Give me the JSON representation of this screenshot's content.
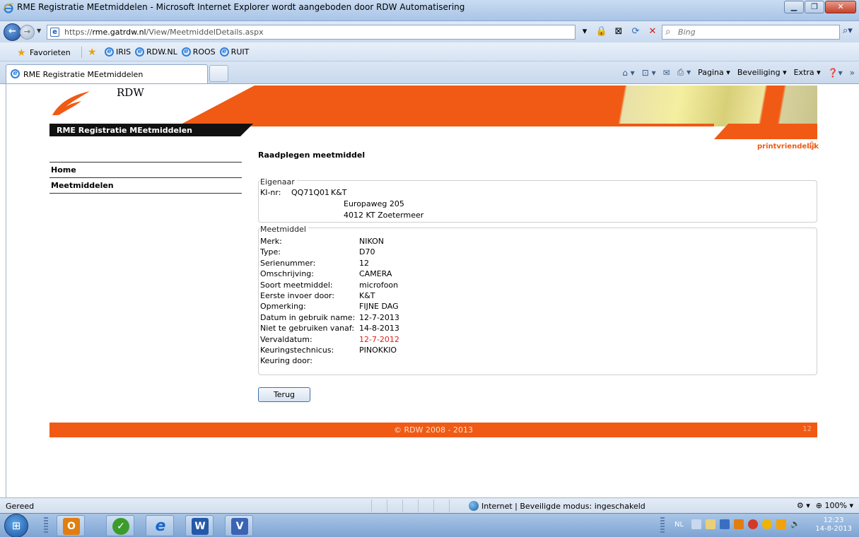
{
  "window": {
    "title": "RME Registratie MEetmiddelen - Microsoft Internet Explorer wordt aangeboden door RDW Automatisering",
    "min_icon": "minimize-icon",
    "max_icon": "maximize-icon",
    "close_icon": "close-icon"
  },
  "addressbar": {
    "url_prefix": "https://",
    "url_host": "rme.gatrdw.nl",
    "url_path": "/View/MeetmiddelDetails.aspx",
    "search_placeholder": "Bing"
  },
  "favorites": {
    "label": "Favorieten",
    "links": [
      "IRIS",
      "RDW.NL",
      "ROOS",
      "RUIT"
    ]
  },
  "tab": {
    "label": "RME Registratie MEetmiddelen"
  },
  "commandbar": {
    "pagina": "Pagina",
    "beveiliging": "Beveiliging",
    "extra": "Extra"
  },
  "page": {
    "brand": "RDW",
    "app_title": "RME Registratie MEetmiddelen",
    "print_link": "printvriendelijk",
    "content_title": "Raadplegen meetmiddel",
    "nav": [
      "Home",
      "Meetmiddelen"
    ],
    "owner": {
      "legend": "Eigenaar",
      "ki_label": "KI-nr:",
      "ki_value": "QQ71Q01",
      "name": "K&T",
      "address1": "Europaweg 205",
      "address2": "4012 KT Zoetermeer"
    },
    "tool": {
      "legend": "Meetmiddel",
      "rows": [
        {
          "k": "Merk:",
          "v": "NIKON"
        },
        {
          "k": "Type:",
          "v": "D70"
        },
        {
          "k": "Serienummer:",
          "v": "12"
        },
        {
          "k": "Omschrijving:",
          "v": "CAMERA"
        },
        {
          "k": "Soort meetmiddel:",
          "v": "microfoon"
        },
        {
          "k": "Eerste invoer door:",
          "v": "K&T"
        },
        {
          "k": "Opmerking:",
          "v": "FIJNE DAG"
        },
        {
          "k": "Datum in gebruik name:",
          "v": "12-7-2013"
        },
        {
          "k": "Niet te gebruiken vanaf:",
          "v": "14-8-2013"
        },
        {
          "k": "Vervaldatum:",
          "v": "12-7-2012"
        },
        {
          "k": "Keuringstechnicus:",
          "v": "PINOKKIO"
        },
        {
          "k": "Keuring door:",
          "v": ""
        }
      ],
      "expired_color": "#e0201b"
    },
    "back_button": "Terug",
    "footer_copy": "© RDW 2008 - 2013",
    "footer_version": "12",
    "brand_color": "#f05a14"
  },
  "statusbar": {
    "status": "Gereed",
    "zone": "Internet | Beveiligde modus: ingeschakeld",
    "zoom": "100%"
  },
  "taskbar": {
    "lang": "NL",
    "time": "12:23",
    "date": "14-8-2013"
  }
}
